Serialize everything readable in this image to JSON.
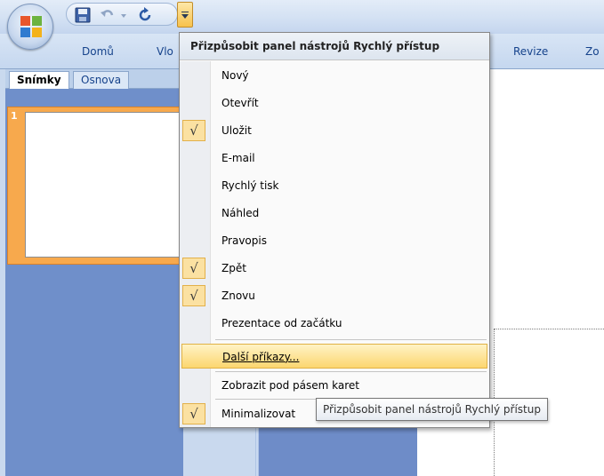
{
  "ribbon": {
    "tabs": [
      {
        "label": "Domů"
      },
      {
        "label": "Vlo"
      },
      {
        "label": "Revize"
      },
      {
        "label": "Zo"
      }
    ]
  },
  "pane": {
    "tabs": [
      {
        "label": "Snímky"
      },
      {
        "label": "Osnova"
      }
    ],
    "slide_number": "1"
  },
  "menu": {
    "title": "Přizpůsobit panel nástrojů Rychlý přístup",
    "items": [
      {
        "label": "Nový",
        "checked": false
      },
      {
        "label": "Otevřít",
        "checked": false
      },
      {
        "label": "Uložit",
        "checked": true
      },
      {
        "label": "E-mail",
        "checked": false
      },
      {
        "label": "Rychlý tisk",
        "checked": false
      },
      {
        "label": "Náhled",
        "checked": false
      },
      {
        "label": "Pravopis",
        "checked": false
      },
      {
        "label": "Zpět",
        "checked": true
      },
      {
        "label": "Znovu",
        "checked": true
      },
      {
        "label": "Prezentace od začátku",
        "checked": false
      }
    ],
    "more_commands": "Další příkazy...",
    "show_below": "Zobrazit pod pásem karet",
    "minimize": "Minimalizovat",
    "check_glyph": "√"
  },
  "tooltip": {
    "text": "Přizpůsobit panel nástrojů Rychlý přístup"
  },
  "colors": {
    "accent_highlight": "#fcd66f",
    "check_bg": "#fbe1a2",
    "ribbon_text": "#15428b",
    "slide_selected": "#f7a94d"
  }
}
